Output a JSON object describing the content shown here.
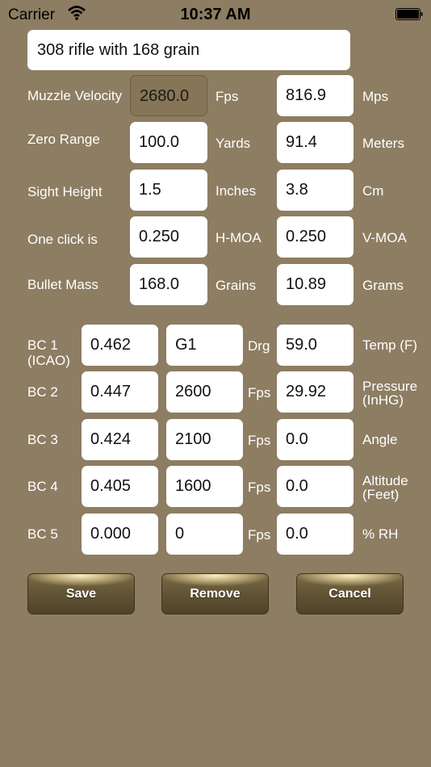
{
  "status_bar": {
    "carrier": "Carrier",
    "time": "10:37 AM"
  },
  "title_field": {
    "value": "308 rifle with 168 grain"
  },
  "rows": [
    {
      "label": "Muzzle Velocity",
      "value1": "2680.0",
      "unit1": "Fps",
      "value2": "816.9",
      "unit2": "Mps"
    },
    {
      "label": "Zero Range",
      "value1": "100.0",
      "unit1": "Yards",
      "value2": "91.4",
      "unit2": "Meters"
    },
    {
      "label": "Sight Height",
      "value1": "1.5",
      "unit1": "Inches",
      "value2": "3.8",
      "unit2": "Cm"
    },
    {
      "label": "One click is",
      "value1": "0.250",
      "unit1": "H-MOA",
      "value2": "0.250",
      "unit2": "V-MOA"
    },
    {
      "label": "Bullet Mass",
      "value1": "168.0",
      "unit1": "Grains",
      "value2": "10.89",
      "unit2": "Grams"
    }
  ],
  "bc_rows": [
    {
      "label_line1": "BC 1",
      "label_line2": "(ICAO)",
      "bc": "0.462",
      "speed": "G1",
      "speed_unit": "Drg",
      "atmo": "59.0",
      "atmo_label_line1": "Temp (F)",
      "atmo_label_line2": ""
    },
    {
      "label_line1": "BC 2",
      "label_line2": "",
      "bc": "0.447",
      "speed": "2600",
      "speed_unit": "Fps",
      "atmo": "29.92",
      "atmo_label_line1": "Pressure",
      "atmo_label_line2": "(InHG)"
    },
    {
      "label_line1": "BC 3",
      "label_line2": "",
      "bc": "0.424",
      "speed": "2100",
      "speed_unit": "Fps",
      "atmo": "0.0",
      "atmo_label_line1": "Angle",
      "atmo_label_line2": ""
    },
    {
      "label_line1": "BC 4",
      "label_line2": "",
      "bc": "0.405",
      "speed": "1600",
      "speed_unit": "Fps",
      "atmo": "0.0",
      "atmo_label_line1": "Altitude",
      "atmo_label_line2": "(Feet)"
    },
    {
      "label_line1": "BC 5",
      "label_line2": "",
      "bc": "0.000",
      "speed": "0",
      "speed_unit": "Fps",
      "atmo": "0.0",
      "atmo_label_line1": "% RH",
      "atmo_label_line2": ""
    }
  ],
  "buttons": {
    "save": "Save",
    "remove": "Remove",
    "cancel": "Cancel"
  },
  "colors": {
    "background": "#8d7d62",
    "field": "#ffffff",
    "label": "#ffffff"
  }
}
